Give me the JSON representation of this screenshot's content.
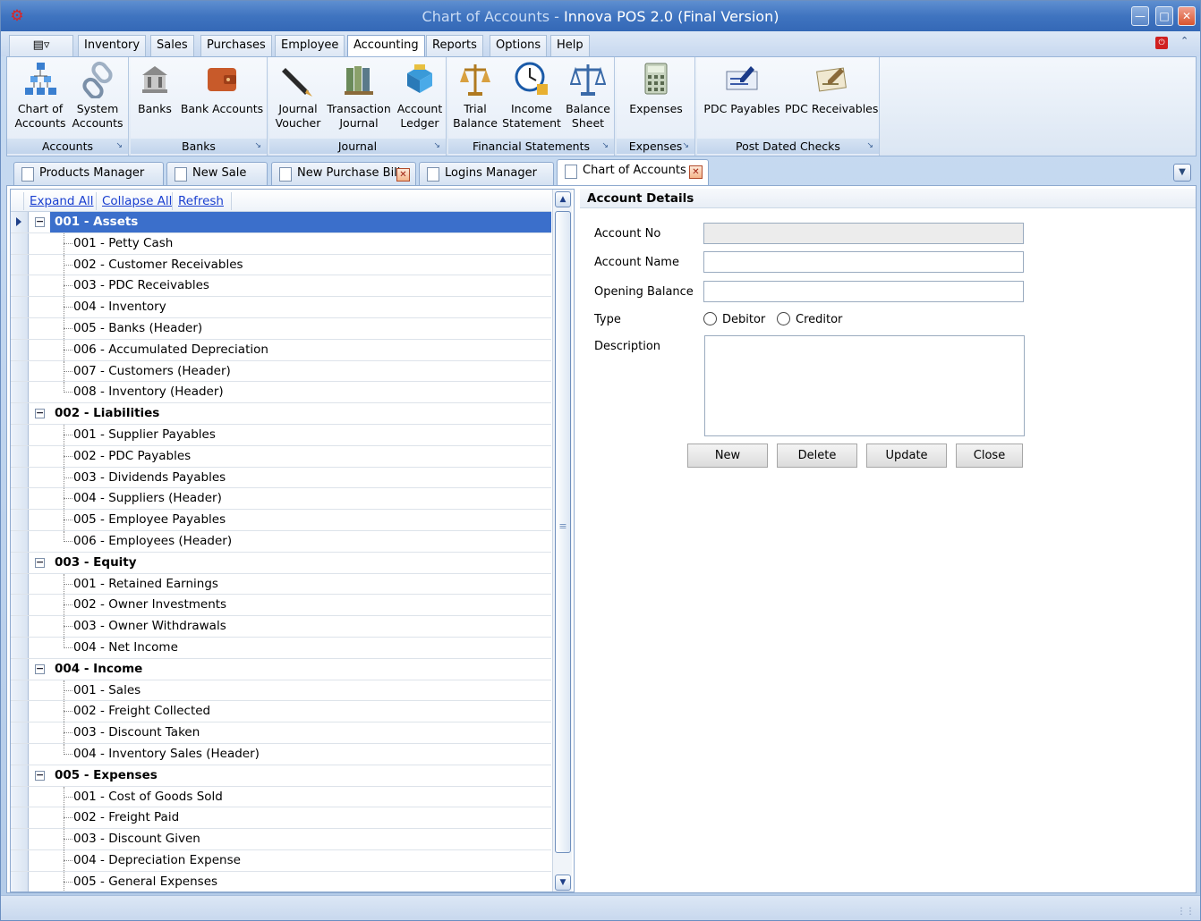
{
  "window": {
    "title_prefix": "Chart of Accounts - ",
    "title_app": "Innova POS 2.0  (Final Version)"
  },
  "menu": {
    "tabs": [
      "Inventory",
      "Sales",
      "Purchases",
      "Employee",
      "Accounting",
      "Reports",
      "Options",
      "Help"
    ],
    "active": "Accounting"
  },
  "ribbon": {
    "groups": [
      {
        "caption": "Accounts",
        "buttons": [
          "Chart of\nAccounts",
          "System\nAccounts"
        ]
      },
      {
        "caption": "Banks",
        "buttons": [
          "Banks",
          "Bank Accounts"
        ]
      },
      {
        "caption": "Journal",
        "buttons": [
          "Journal\nVoucher",
          "Transaction\nJournal",
          "Account\nLedger"
        ]
      },
      {
        "caption": "Financial Statements",
        "buttons": [
          "Trial\nBalance",
          "Income\nStatement",
          "Balance\nSheet"
        ]
      },
      {
        "caption": "Expenses",
        "buttons": [
          "Expenses"
        ]
      },
      {
        "caption": "Post Dated Checks",
        "buttons": [
          "PDC Payables",
          "PDC Receivables"
        ]
      }
    ]
  },
  "doc_tabs": [
    "Products Manager",
    "New Sale",
    "New Purchase Bill",
    "Logins Manager",
    "Chart of Accounts"
  ],
  "tree": {
    "toolbar": {
      "expand": "Expand All",
      "collapse": "Collapse All",
      "refresh": "Refresh"
    },
    "rows": [
      {
        "text": "001 - Assets",
        "level": 0,
        "selected": true
      },
      {
        "text": "001 - Petty Cash",
        "level": 1
      },
      {
        "text": "002 - Customer Receivables",
        "level": 1
      },
      {
        "text": "003 - PDC Receivables",
        "level": 1
      },
      {
        "text": "004 - Inventory",
        "level": 1
      },
      {
        "text": "005 - Banks (Header)",
        "level": 1
      },
      {
        "text": "006 - Accumulated Depreciation",
        "level": 1
      },
      {
        "text": "007 - Customers (Header)",
        "level": 1
      },
      {
        "text": "008 - Inventory (Header)",
        "level": 1,
        "last": true
      },
      {
        "text": "002 - Liabilities",
        "level": 0
      },
      {
        "text": "001 - Supplier Payables",
        "level": 1
      },
      {
        "text": "002 - PDC Payables",
        "level": 1
      },
      {
        "text": "003 - Dividends Payables",
        "level": 1
      },
      {
        "text": "004 - Suppliers (Header)",
        "level": 1
      },
      {
        "text": "005 - Employee Payables",
        "level": 1
      },
      {
        "text": "006 - Employees (Header)",
        "level": 1,
        "last": true
      },
      {
        "text": "003 - Equity",
        "level": 0
      },
      {
        "text": "001 - Retained Earnings",
        "level": 1
      },
      {
        "text": "002 - Owner Investments",
        "level": 1
      },
      {
        "text": "003 - Owner Withdrawals",
        "level": 1
      },
      {
        "text": "004 - Net Income",
        "level": 1,
        "last": true
      },
      {
        "text": "004 - Income",
        "level": 0
      },
      {
        "text": "001 - Sales",
        "level": 1
      },
      {
        "text": "002 - Freight Collected",
        "level": 1
      },
      {
        "text": "003 - Discount Taken",
        "level": 1
      },
      {
        "text": "004 - Inventory Sales (Header)",
        "level": 1,
        "last": true
      },
      {
        "text": "005 - Expenses",
        "level": 0
      },
      {
        "text": "001 - Cost of Goods Sold",
        "level": 1
      },
      {
        "text": "002 - Freight Paid",
        "level": 1
      },
      {
        "text": "003 - Discount Given",
        "level": 1
      },
      {
        "text": "004 - Depreciation Expense",
        "level": 1
      },
      {
        "text": "005 - General Expenses",
        "level": 1
      }
    ]
  },
  "details": {
    "title": "Account Details",
    "account_no_label": "Account No",
    "account_no_value": "",
    "account_name_label": "Account Name",
    "account_name_value": "",
    "opening_balance_label": "Opening Balance",
    "opening_balance_value": "",
    "type_label": "Type",
    "debitor_label": "Debitor",
    "creditor_label": "Creditor",
    "description_label": "Description",
    "description_value": "",
    "buttons": {
      "new": "New",
      "delete": "Delete",
      "update": "Update",
      "close": "Close"
    }
  }
}
